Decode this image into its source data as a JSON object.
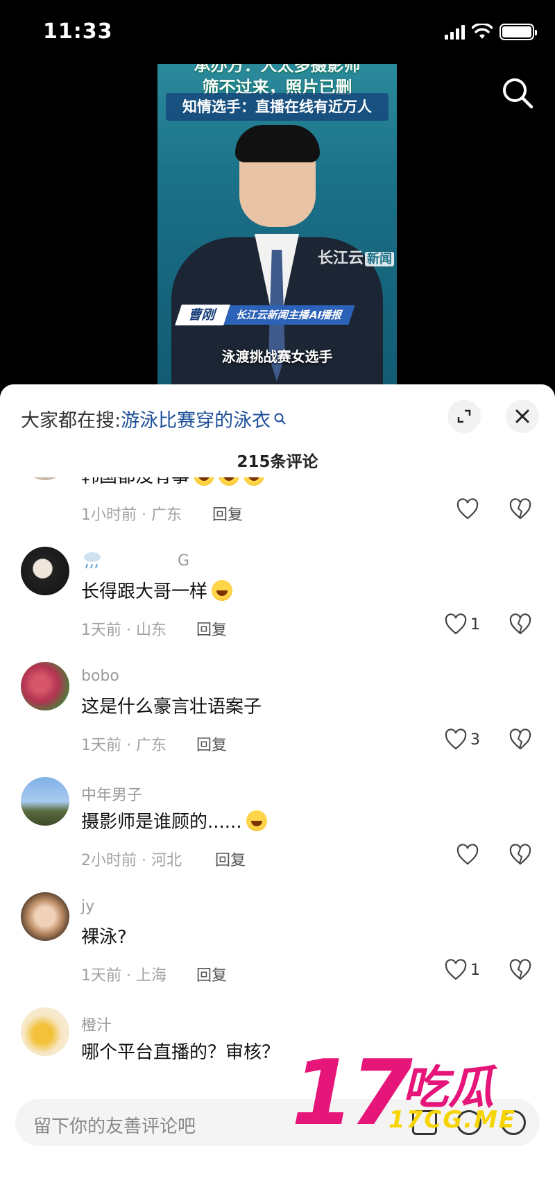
{
  "status_bar": {
    "time": "11:33"
  },
  "video": {
    "headline_partial": "承办方：人太多摄影师",
    "headline_line2": "筛不过来，照片已删",
    "subhead": "知情选手：直播在线有近万人",
    "channel_logo": "长江云",
    "channel_logo_tag": "新闻",
    "anchor_name": "曹刚",
    "anchor_title": "长江云新闻主播AI播报",
    "caption": "泳渡挑战赛女选手"
  },
  "sheet": {
    "hot_search_prefix": "大家都在搜:",
    "hot_search_query": "游泳比赛穿的泳衣",
    "comment_count": "215条评论"
  },
  "comments": [
    {
      "name": "",
      "text": "韩国都没有事",
      "emoji_count": 3,
      "time_location": "1小时前 · 广东",
      "reply": "回复",
      "likes": ""
    },
    {
      "name": "G",
      "text": "长得跟大哥一样",
      "emoji_count": 1,
      "time_location": "1天前 · 山东",
      "reply": "回复",
      "likes": "1"
    },
    {
      "name": "bobo",
      "text": "这是什么豪言壮语案子",
      "emoji_count": 0,
      "time_location": "1天前 · 广东",
      "reply": "回复",
      "likes": "3"
    },
    {
      "name": "中年男子",
      "text": "摄影师是谁顾的......",
      "emoji_count": 1,
      "time_location": "2小时前 · 河北",
      "reply": "回复",
      "likes": ""
    },
    {
      "name": "jy",
      "text": "裸泳?",
      "emoji_count": 0,
      "time_location": "1天前 · 上海",
      "reply": "回复",
      "likes": "1"
    },
    {
      "name": "橙汁",
      "text": "哪个平台直播的？审核？",
      "emoji_count": 0,
      "time_location": "",
      "reply": "",
      "likes": ""
    }
  ],
  "input": {
    "placeholder": "留下你的友善评论吧"
  },
  "watermark": {
    "big": "17",
    "cn": "吃瓜",
    "domain": "17CG.ME"
  },
  "colors": {
    "accent_link": "#1d4f9a",
    "watermark_pink": "#e6157a",
    "watermark_yellow": "#f6d400"
  },
  "icons": [
    "search-icon",
    "expand-icon",
    "close-icon",
    "heart-icon",
    "broken-heart-icon",
    "image-icon",
    "at-icon",
    "emoji-icon"
  ]
}
